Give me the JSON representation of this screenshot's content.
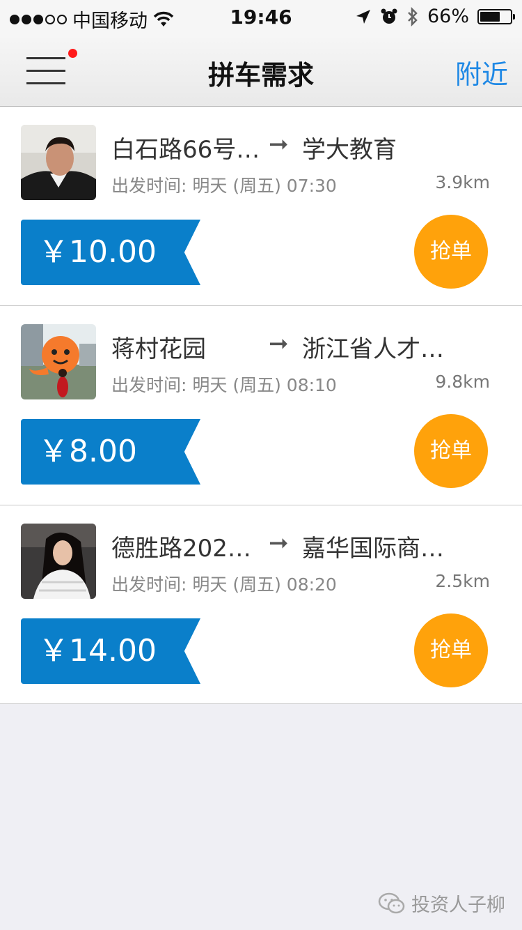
{
  "status_bar": {
    "carrier": "中国移动",
    "time": "19:46",
    "battery_percent": "66%",
    "battery_level": 0.66
  },
  "nav": {
    "title": "拼车需求",
    "right_label": "附近"
  },
  "requests": [
    {
      "from": "白石路66号…",
      "to": "学大教育",
      "time_label": "出发时间:",
      "time": "明天 (周五) 07:30",
      "distance": "3.9km",
      "price": "￥10.00",
      "action": "抢单"
    },
    {
      "from": "蒋村花园",
      "to": "浙江省人才…",
      "time_label": "出发时间:",
      "time": "明天 (周五) 08:10",
      "distance": "9.8km",
      "price": "￥8.00",
      "action": "抢单"
    },
    {
      "from": "德胜路202…",
      "to": "嘉华国际商…",
      "time_label": "出发时间:",
      "time": "明天 (周五) 08:20",
      "distance": "2.5km",
      "price": "￥14.00",
      "action": "抢单"
    }
  ],
  "watermark": "投资人子柳",
  "colors": {
    "accent_blue": "#0a7fca",
    "link_blue": "#1e88e5",
    "grab_orange": "#ffa20b",
    "badge_red": "#ff1a1a",
    "background": "#efeff4"
  }
}
